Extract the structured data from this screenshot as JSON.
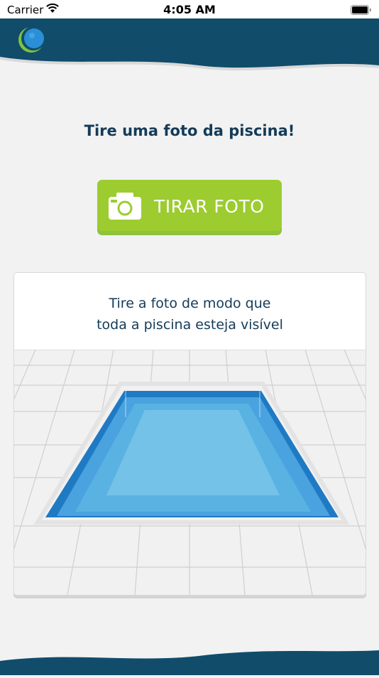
{
  "status_bar": {
    "carrier": "Carrier",
    "time": "4:05 AM"
  },
  "header": {
    "logo_icon": "app-logo-icon"
  },
  "main": {
    "title": "Tire uma foto da piscina!",
    "photo_button": {
      "label": "TIRAR FOTO",
      "icon": "camera-icon"
    },
    "instruction_lines": [
      "Tire a foto de modo que",
      "toda a piscina esteja visível"
    ]
  },
  "colors": {
    "header_navy": "#114c6b",
    "button_green": "#9ccc2f",
    "title_text": "#143b58",
    "pool_blue": "#1f7ac4",
    "pool_water": "#6fbde2"
  }
}
